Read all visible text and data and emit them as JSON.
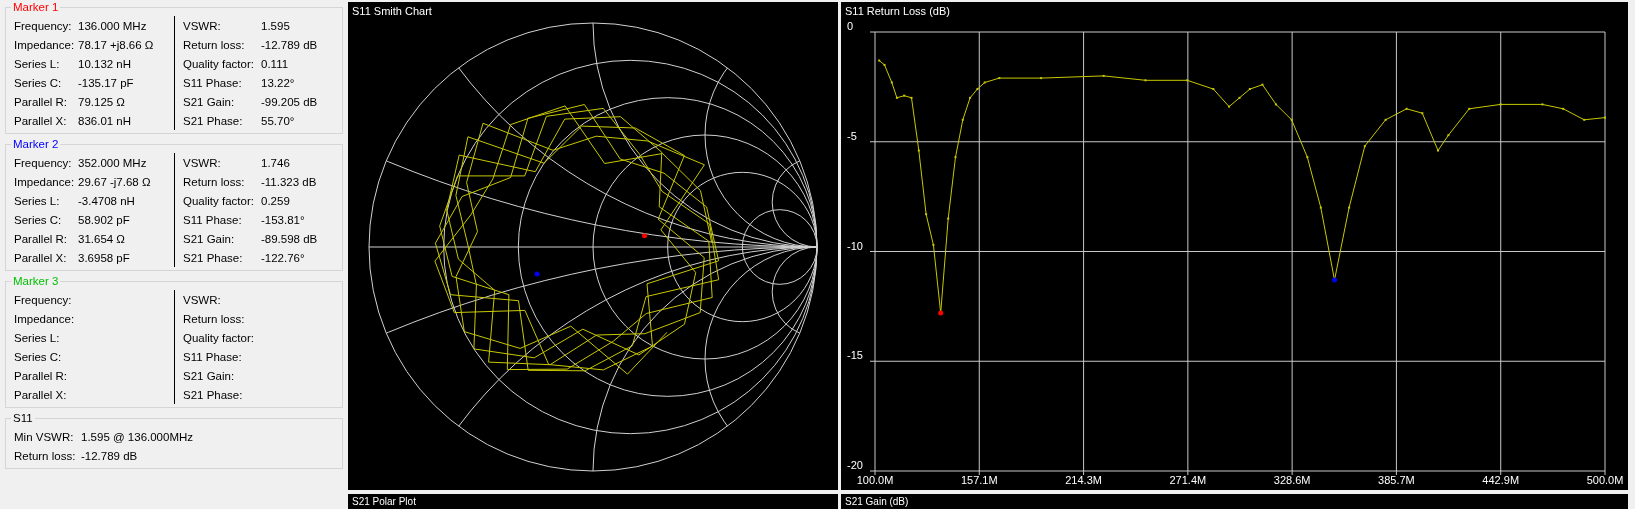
{
  "markers": [
    {
      "title": "Marker 1",
      "color": "#ff0000",
      "left": [
        {
          "label": "Frequency:",
          "value": "136.000 MHz"
        },
        {
          "label": "Impedance:",
          "value": "78.17 +j8.66 Ω"
        },
        {
          "label": "Series L:",
          "value": "10.132 nH"
        },
        {
          "label": "Series C:",
          "value": "-135.17 pF"
        },
        {
          "label": "Parallel R:",
          "value": "79.125 Ω"
        },
        {
          "label": "Parallel X:",
          "value": "836.01 nH"
        }
      ],
      "right": [
        {
          "label": "VSWR:",
          "value": "1.595"
        },
        {
          "label": "Return loss:",
          "value": "-12.789 dB"
        },
        {
          "label": "Quality factor:",
          "value": "0.111"
        },
        {
          "label": "S11 Phase:",
          "value": "13.22°"
        },
        {
          "label": "S21 Gain:",
          "value": "-99.205 dB"
        },
        {
          "label": "S21 Phase:",
          "value": "55.70°"
        }
      ]
    },
    {
      "title": "Marker 2",
      "color": "#0000ff",
      "left": [
        {
          "label": "Frequency:",
          "value": "352.000 MHz"
        },
        {
          "label": "Impedance:",
          "value": "29.67 -j7.68 Ω"
        },
        {
          "label": "Series L:",
          "value": "-3.4708 nH"
        },
        {
          "label": "Series C:",
          "value": "58.902 pF"
        },
        {
          "label": "Parallel R:",
          "value": "31.654 Ω"
        },
        {
          "label": "Parallel X:",
          "value": "3.6958 pF"
        }
      ],
      "right": [
        {
          "label": "VSWR:",
          "value": "1.746"
        },
        {
          "label": "Return loss:",
          "value": "-11.323 dB"
        },
        {
          "label": "Quality factor:",
          "value": "0.259"
        },
        {
          "label": "S11 Phase:",
          "value": "-153.81°"
        },
        {
          "label": "S21 Gain:",
          "value": "-89.598 dB"
        },
        {
          "label": "S21 Phase:",
          "value": "-122.76°"
        }
      ]
    },
    {
      "title": "Marker 3",
      "color": "#00c000",
      "left": [
        {
          "label": "Frequency:"
        },
        {
          "label": "Impedance:"
        },
        {
          "label": "Series L:"
        },
        {
          "label": "Series C:"
        },
        {
          "label": "Parallel R:"
        },
        {
          "label": "Parallel X:"
        }
      ],
      "right": [
        {
          "label": "VSWR:"
        },
        {
          "label": "Return loss:"
        },
        {
          "label": "Quality factor:"
        },
        {
          "label": "S11 Phase:"
        },
        {
          "label": "S21 Gain:"
        },
        {
          "label": "S21 Phase:"
        }
      ]
    }
  ],
  "s11_summary": {
    "title": "S11",
    "rows": [
      {
        "label": "Min VSWR:",
        "value": "1.595 @ 136.000MHz"
      },
      {
        "label": "Return loss:",
        "value": "-12.789 dB"
      }
    ]
  },
  "smith_chart": {
    "title": "S11 Smith Chart"
  },
  "return_loss": {
    "title": "S11 Return Loss (dB)",
    "chart_data": {
      "type": "line",
      "x": [
        102.3,
        105.2,
        109.2,
        112.0,
        116.0,
        120.0,
        124.0,
        128.0,
        132.0,
        136.0,
        140.1,
        144.1,
        148.1,
        152.1,
        156.1,
        160.1,
        168.1,
        191.0,
        225.3,
        248.2,
        271.1,
        285.4,
        294.0,
        299.7,
        305.4,
        312.3,
        319.7,
        328.3,
        336.9,
        344.3,
        351.8,
        359.8,
        368.4,
        379.8,
        391.3,
        399.9,
        408.5,
        414.2,
        425.6,
        442.8,
        465.7,
        477.1,
        488.6,
        500.0
      ],
      "series": [
        {
          "color": "#c8c800",
          "marker": "square",
          "values": [
            -1.3,
            -1.5,
            -2.3,
            -3.0,
            -2.9,
            -3.0,
            -5.4,
            -8.3,
            -9.7,
            -12.8,
            -8.5,
            -5.7,
            -4.0,
            -3.0,
            -2.6,
            -2.3,
            -2.1,
            -2.1,
            -2.0,
            -2.2,
            -2.2,
            -2.6,
            -3.4,
            -3.0,
            -2.6,
            -2.4,
            -3.3,
            -4.0,
            -5.7,
            -8.0,
            -11.3,
            -8.0,
            -5.2,
            -4.0,
            -3.5,
            -3.7,
            -5.4,
            -4.7,
            -3.5,
            -3.3,
            -3.3,
            -3.5,
            -4.0,
            -3.9
          ]
        }
      ],
      "xlim": [
        100,
        500
      ],
      "ylim": [
        -20,
        0
      ],
      "xticks": [
        {
          "value": 100,
          "label": "100.0M"
        },
        {
          "value": 157.14,
          "label": "157.1M"
        },
        {
          "value": 214.29,
          "label": "214.3M"
        },
        {
          "value": 271.43,
          "label": "271.4M"
        },
        {
          "value": 328.57,
          "label": "328.6M"
        },
        {
          "value": 385.71,
          "label": "385.7M"
        },
        {
          "value": 442.86,
          "label": "442.9M"
        },
        {
          "value": 500,
          "label": "500.0M"
        }
      ],
      "yticks": [
        0,
        -5,
        -10,
        -15,
        -20
      ],
      "grid": true
    }
  },
  "bottom_panels": [
    {
      "title": "S21 Polar Plot"
    },
    {
      "title": "S21 Gain (dB)"
    }
  ]
}
